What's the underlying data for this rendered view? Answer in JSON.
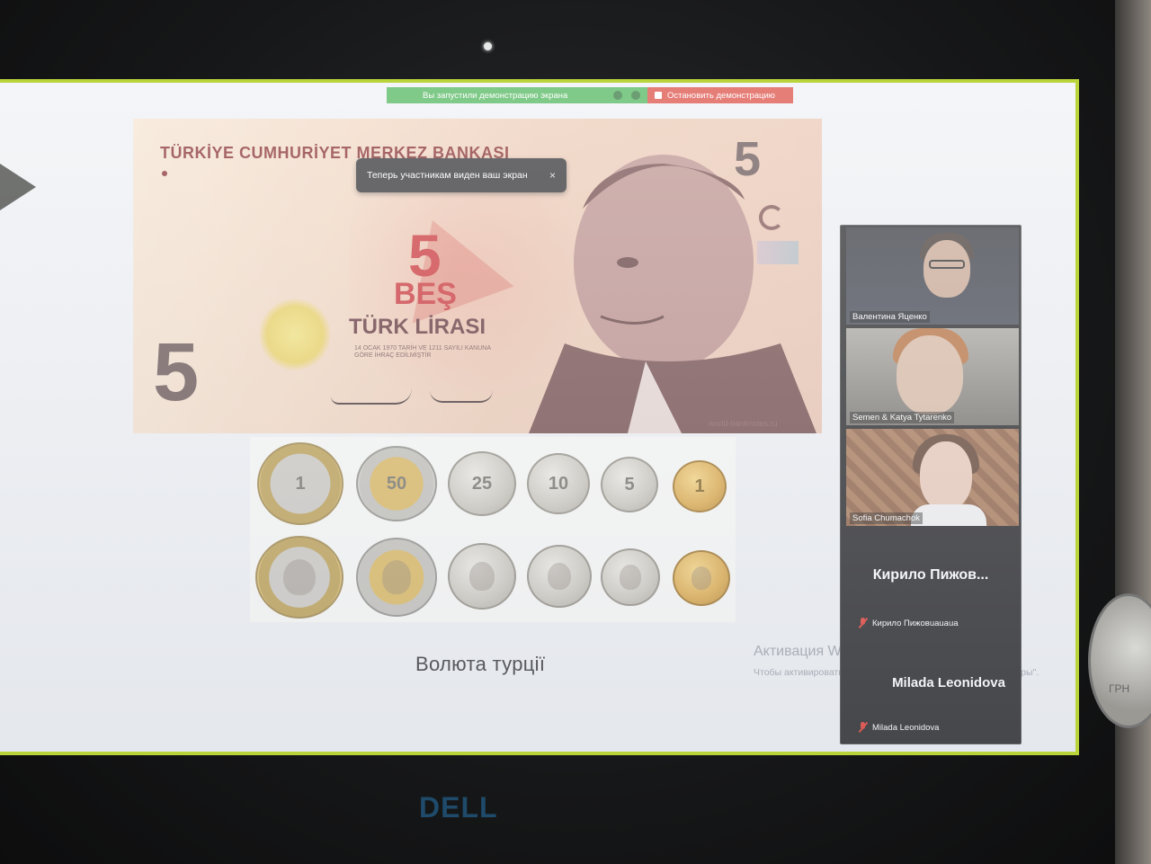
{
  "share_bar": {
    "status_text": "Вы запустили демонстрацию экрана",
    "stop_label": "Остановить демонстрацию"
  },
  "toast": {
    "message": "Теперь участникам виден ваш экран",
    "close_label": "×"
  },
  "banknote": {
    "bank_name": "TÜRKİYE CUMHURİYET MERKEZ BANKASI",
    "numeral": "5",
    "word": "BEŞ",
    "currency": "TÜRK LİRASI",
    "small_print": "14 OCAK 1970 TARİH VE 1211 SAYILI KANUNA GÖRE İHRAÇ EDİLMİŞTİR",
    "site": "world-banknotes.ru"
  },
  "coins": {
    "top_row": [
      "1",
      "50",
      "25",
      "10",
      "5",
      "1"
    ]
  },
  "slide": {
    "caption": "Волюта турції"
  },
  "watermark": {
    "title": "Активация Windows",
    "subtitle": "Чтобы активировать Windows, перейдите в раздел \"Параметры\"."
  },
  "participants": [
    {
      "name": "Валентина Яценко"
    },
    {
      "name": "Semen & Katya Tytarenko"
    },
    {
      "name": "Sofia Chumachok"
    },
    {
      "display": "Кирило  Пижов...",
      "name": "Кирило Пижовuauaua"
    },
    {
      "display": "Milada Leonidova",
      "name": "Milada Leonidova"
    }
  ],
  "device": {
    "logo": "DELL",
    "coin_text": "ГРН"
  },
  "colors": {
    "share_green": "#3cae4a",
    "stop_red": "#d93a30",
    "screen_border": "#b8d43a",
    "note_red": "#c8282c"
  }
}
